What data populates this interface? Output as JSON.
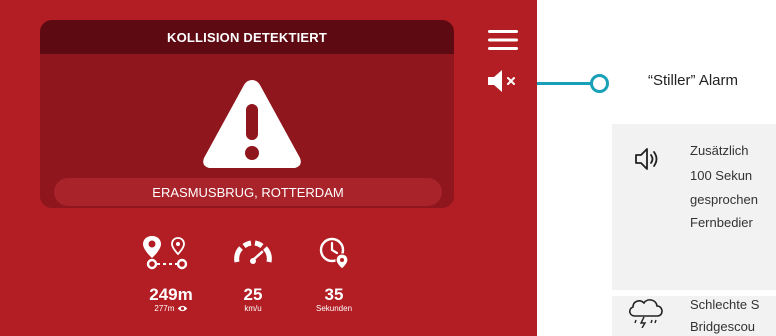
{
  "alert": {
    "title": "KOLLISION DETEKTIERT",
    "location": "ERASMUSBRUG, ROTTERDAM"
  },
  "stats": {
    "distance": {
      "value": "249m",
      "sub": "277m",
      "icon": "route-pins-icon"
    },
    "speed": {
      "value": "25",
      "unit": "km/u",
      "icon": "speedometer-icon"
    },
    "time": {
      "value": "35",
      "unit": "Sekunden",
      "icon": "clock-pin-icon"
    }
  },
  "controls": {
    "menu_icon": "hamburger-menu-icon",
    "mute_icon": "speaker-muted-icon"
  },
  "callout": {
    "label": "“Stiller” Alarm"
  },
  "info1": {
    "icon": "speaker-icon",
    "lines": [
      "Zusätzlich",
      "100 Sekun",
      "gesprochen",
      "Fernbedier"
    ]
  },
  "info2": {
    "icon": "storm-cloud-icon",
    "lines": [
      "Schlechte S",
      "Bridgescou"
    ]
  },
  "colors": {
    "app_bg": "#b21e24",
    "card_bg": "#8f161c",
    "header_bg": "#5e0a12",
    "accent": "#17a0b8"
  }
}
